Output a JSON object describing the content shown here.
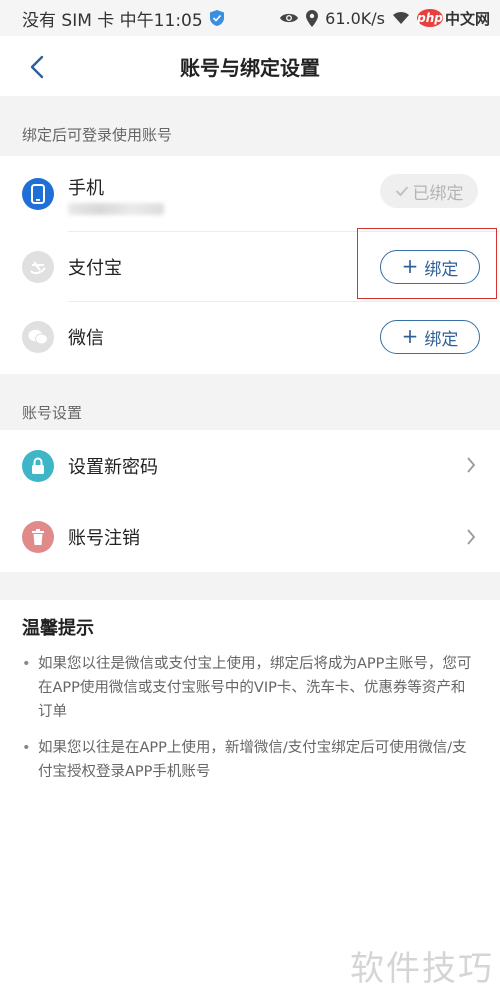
{
  "status_bar": {
    "left_text": "没有 SIM 卡 中午11:05",
    "network_speed": "61.0K/s",
    "brand_php": "php",
    "brand_cn": "中文网"
  },
  "nav": {
    "title": "账号与绑定设置"
  },
  "binding_section": {
    "label": "绑定后可登录使用账号",
    "phone": {
      "title": "手机",
      "status": "已绑定"
    },
    "alipay": {
      "title": "支付宝",
      "button": "绑定"
    },
    "wechat": {
      "title": "微信",
      "button": "绑定"
    }
  },
  "account_section": {
    "label": "账号设置",
    "set_password": "设置新密码",
    "cancel_account": "账号注销"
  },
  "tips": {
    "title": "温馨提示",
    "items": [
      "如果您以往是微信或支付宝上使用，绑定后将成为APP主账号，您可在APP使用微信或支付宝账号中的VIP卡、洗车卡、优惠券等资产和订单",
      "如果您以往是在APP上使用，新增微信/支付宝绑定后可使用微信/支付宝授权登录APP手机账号"
    ]
  },
  "watermark": "软件技巧",
  "colors": {
    "accent": "#2f5f97",
    "phone_icon": "#1f6fd6",
    "lock_icon": "#3fb6c8",
    "trash_icon": "#e08a8a",
    "highlight": "#d6332e"
  }
}
